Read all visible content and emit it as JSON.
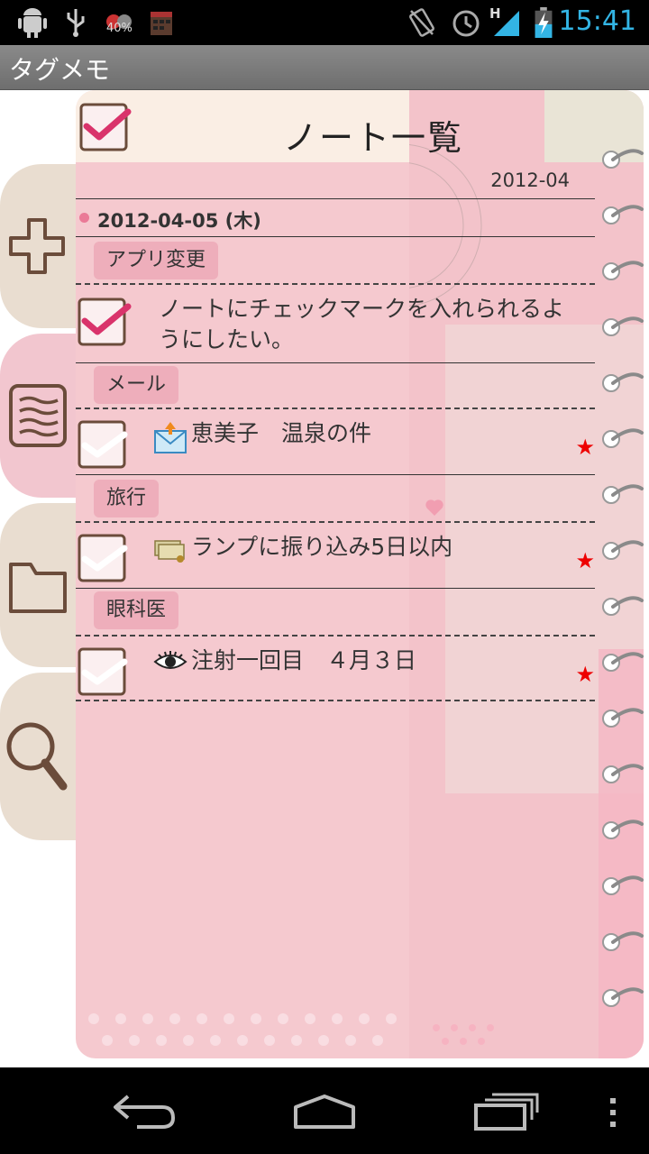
{
  "status_bar": {
    "battery_percent_label": "40%",
    "network_label": "H",
    "time": "15:41"
  },
  "app": {
    "title": "タグメモ"
  },
  "side_tabs": [
    {
      "name": "add",
      "icon": "plus-icon"
    },
    {
      "name": "note-list",
      "icon": "note-lines-icon"
    },
    {
      "name": "folder",
      "icon": "folder-icon"
    },
    {
      "name": "search",
      "icon": "magnifier-icon"
    }
  ],
  "notebook": {
    "title": "ノート一覧",
    "month": "2012-04",
    "date": "2012-04-05 (木)",
    "groups": [
      {
        "tag": "アプリ変更",
        "note": {
          "text": "ノートにチェックマークを入れられるようにしたい。",
          "checked": true,
          "icon": "",
          "starred": false
        }
      },
      {
        "tag": "メール",
        "note": {
          "text": "恵美子　温泉の件",
          "checked": false,
          "icon": "mail-upload-icon",
          "starred": true
        }
      },
      {
        "tag": "旅行",
        "note": {
          "text": "ランプに振り込み5日以内",
          "checked": false,
          "icon": "money-icon",
          "starred": true
        }
      },
      {
        "tag": "眼科医",
        "note": {
          "text": "注射一回目　４月３日",
          "checked": false,
          "icon": "eye-icon",
          "starred": true
        }
      }
    ],
    "star_color": "#e00000",
    "accent_pink": "#ea7a97"
  },
  "colors": {
    "page_bg": "#f5c9cf",
    "tag_chip": "#eeaebb",
    "tab_bg": "#e9ddd0",
    "tab_active": "#f2c6cf"
  }
}
